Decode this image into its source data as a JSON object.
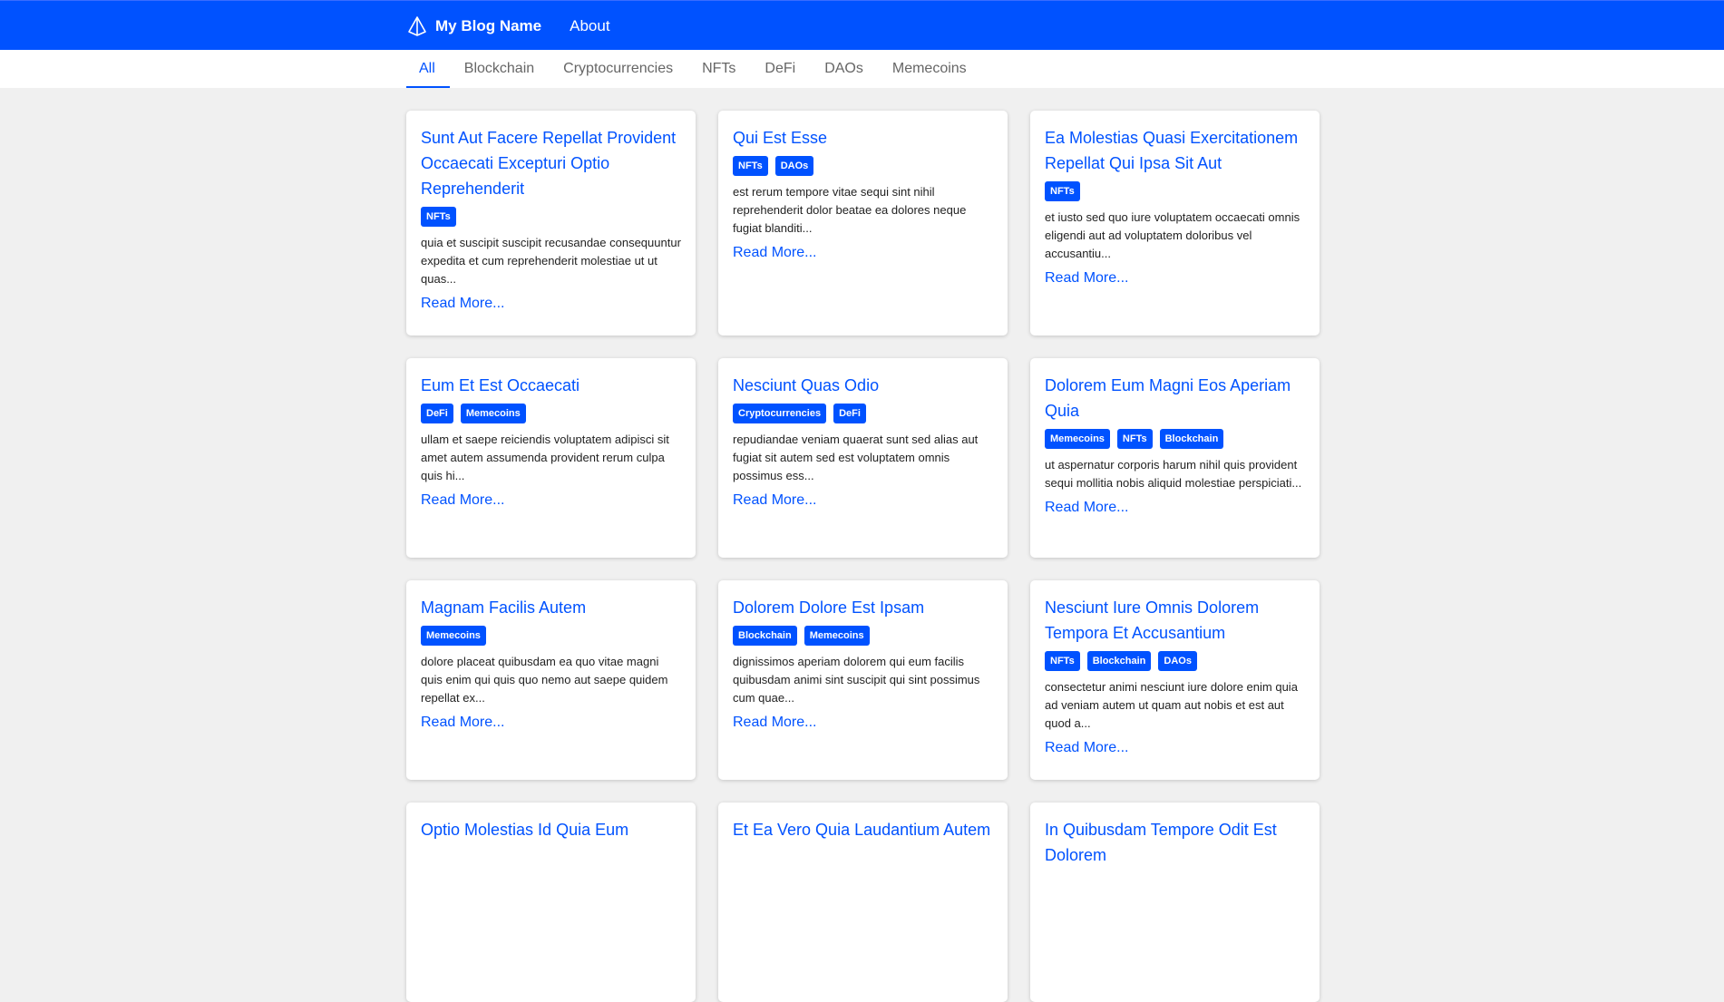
{
  "nav": {
    "brand": "My Blog Name",
    "about": "About"
  },
  "tabs": [
    "All",
    "Blockchain",
    "Cryptocurrencies",
    "NFTs",
    "DeFi",
    "DAOs",
    "Memecoins"
  ],
  "read_more_label": "Read More...",
  "posts": [
    {
      "title": "Sunt Aut Facere Repellat Provident Occaecati Excepturi Optio Reprehenderit",
      "tags": [
        "NFTs"
      ],
      "excerpt": "quia et suscipit suscipit recusandae consequuntur expedita et cum reprehenderit molestiae ut ut quas..."
    },
    {
      "title": "Qui Est Esse",
      "tags": [
        "NFTs",
        "DAOs"
      ],
      "excerpt": "est rerum tempore vitae sequi sint nihil reprehenderit dolor beatae ea dolores neque fugiat blanditi..."
    },
    {
      "title": "Ea Molestias Quasi Exercitationem Repellat Qui Ipsa Sit Aut",
      "tags": [
        "NFTs"
      ],
      "excerpt": "et iusto sed quo iure voluptatem occaecati omnis eligendi aut ad voluptatem doloribus vel accusantiu..."
    },
    {
      "title": "Eum Et Est Occaecati",
      "tags": [
        "DeFi",
        "Memecoins"
      ],
      "excerpt": "ullam et saepe reiciendis voluptatem adipisci sit amet autem assumenda provident rerum culpa quis hi..."
    },
    {
      "title": "Nesciunt Quas Odio",
      "tags": [
        "Cryptocurrencies",
        "DeFi"
      ],
      "excerpt": "repudiandae veniam quaerat sunt sed alias aut fugiat sit autem sed est voluptatem omnis possimus ess..."
    },
    {
      "title": "Dolorem Eum Magni Eos Aperiam Quia",
      "tags": [
        "Memecoins",
        "NFTs",
        "Blockchain"
      ],
      "excerpt": "ut aspernatur corporis harum nihil quis provident sequi mollitia nobis aliquid molestiae perspiciati..."
    },
    {
      "title": "Magnam Facilis Autem",
      "tags": [
        "Memecoins"
      ],
      "excerpt": "dolore placeat quibusdam ea quo vitae magni quis enim qui quis quo nemo aut saepe quidem repellat ex..."
    },
    {
      "title": "Dolorem Dolore Est Ipsam",
      "tags": [
        "Blockchain",
        "Memecoins"
      ],
      "excerpt": "dignissimos aperiam dolorem qui eum facilis quibusdam animi sint suscipit qui sint possimus cum quae..."
    },
    {
      "title": "Nesciunt Iure Omnis Dolorem Tempora Et Accusantium",
      "tags": [
        "NFTs",
        "Blockchain",
        "DAOs"
      ],
      "excerpt": "consectetur animi nesciunt iure dolore enim quia ad veniam autem ut quam aut nobis et est aut quod a..."
    },
    {
      "title": "Optio Molestias Id Quia Eum",
      "tags": [],
      "excerpt": ""
    },
    {
      "title": "Et Ea Vero Quia Laudantium Autem",
      "tags": [],
      "excerpt": ""
    },
    {
      "title": "In Quibusdam Tempore Odit Est Dolorem",
      "tags": [],
      "excerpt": ""
    }
  ],
  "colors": {
    "accent": "#0052ff",
    "background": "#f0f0f0"
  }
}
